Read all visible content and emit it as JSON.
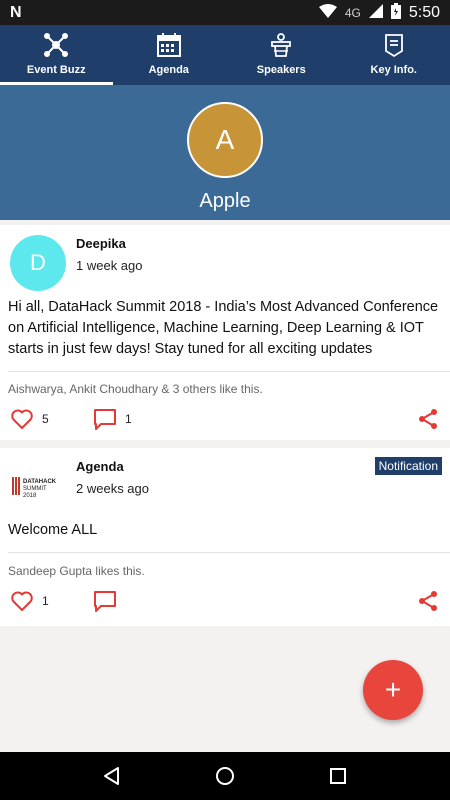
{
  "status_bar": {
    "network": "4G",
    "time": "5:50"
  },
  "tabs": [
    {
      "label": "Event Buzz",
      "icon": "network-icon",
      "active": true
    },
    {
      "label": "Agenda",
      "icon": "calendar-icon",
      "active": false
    },
    {
      "label": "Speakers",
      "icon": "podium-icon",
      "active": false
    },
    {
      "label": "Key Info.",
      "icon": "info-badge-icon",
      "active": false
    }
  ],
  "profile": {
    "initial": "A",
    "name": "Apple"
  },
  "posts": [
    {
      "avatar_initial": "D",
      "author": "Deepika",
      "time": "1 week ago",
      "body": "Hi all, DataHack Summit 2018 - India’s Most Advanced Conference on Artificial Intelligence, Machine Learning, Deep Learning & IOT starts in just few days! Stay tuned for all exciting updates",
      "likes_text": "Aishwarya, Ankit Choudhary & 3 others like this.",
      "like_count": "5",
      "comment_count": "1"
    },
    {
      "logo_text_1": "DATAHACK",
      "logo_text_2": "SUMMIT",
      "logo_text_3": "2018",
      "author": "Agenda",
      "time": "2 weeks ago",
      "badge": "Notification",
      "body": "Welcome ALL",
      "likes_text": "Sandeep Gupta likes this.",
      "like_count": "1"
    }
  ],
  "fab": {
    "label": "+"
  },
  "colors": {
    "header": "#1f3f6a",
    "profile_bg": "#3a6a95",
    "avatar_profile": "#c89438",
    "avatar_post": "#5de8ee",
    "accent": "#e8463d"
  }
}
